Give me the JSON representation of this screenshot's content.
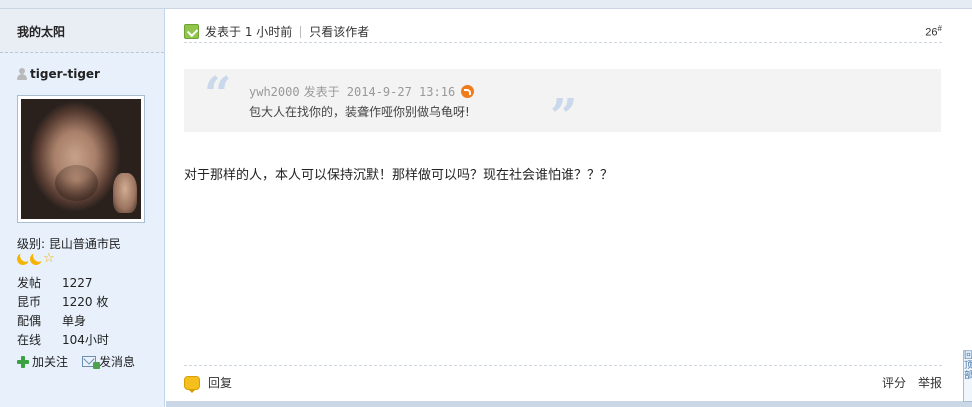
{
  "sidebar": {
    "title": "我的太阳",
    "user": {
      "name": "tiger-tiger",
      "level_label": "级别:",
      "level_value": "昆山普通市民"
    },
    "stats": [
      {
        "label": "发帖",
        "value": "1227"
      },
      {
        "label": "昆币",
        "value": "1220 枚"
      },
      {
        "label": "配偶",
        "value": "单身"
      },
      {
        "label": "在线",
        "value": "104小时"
      }
    ],
    "actions": {
      "follow": "加关注",
      "message": "发消息"
    }
  },
  "post": {
    "posted_time": "发表于 1 小时前",
    "only_author": "只看该作者",
    "floor": "26",
    "floor_mark": "#",
    "quote": {
      "author": "ywh2000",
      "meta": "发表于 2014-9-27 13:16",
      "text": "包大人在找你的，装聋作哑你别做乌龟呀!"
    },
    "body": "对于那样的人，本人可以保持沉默！那样做可以吗？现在社会谁怕谁？？？",
    "footer": {
      "reply": "回复",
      "rate": "评分",
      "report": "举报"
    }
  },
  "scroll_top": {
    "label": "回顶部"
  },
  "icons": [
    "user-icon",
    "moon-icon",
    "star-icon",
    "plus-icon",
    "mail-icon",
    "post-icon",
    "back-icon",
    "reply-icon",
    "quote-open-icon",
    "quote-close-icon"
  ],
  "colors": {
    "sidebar_bg": "#e7f0fb",
    "quote_bg": "#f3f3f3",
    "accent_green": "#3aa142",
    "accent_orange": "#f07b1a",
    "badge_gold": "#f4b400"
  }
}
